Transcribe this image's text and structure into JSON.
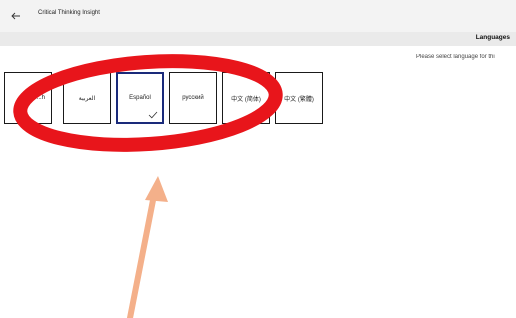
{
  "window": {
    "app_title": "Critical Thinking Insight"
  },
  "header": {
    "section_title": "Languages"
  },
  "main": {
    "instruction": "Please select language for thi",
    "languages": [
      {
        "label": "...h",
        "selected": false
      },
      {
        "label": "العربية",
        "selected": false
      },
      {
        "label": "Español",
        "selected": true
      },
      {
        "label": "русский",
        "selected": false
      },
      {
        "label": "中文 (简体)",
        "selected": false
      },
      {
        "label": "中文 (繁體)",
        "selected": false
      }
    ]
  },
  "annotation": {
    "ellipse_color": "#e8151b",
    "arrow_color": "#f4b08a"
  },
  "icons": {
    "back": "back-arrow-icon",
    "check": "checkmark-icon"
  }
}
